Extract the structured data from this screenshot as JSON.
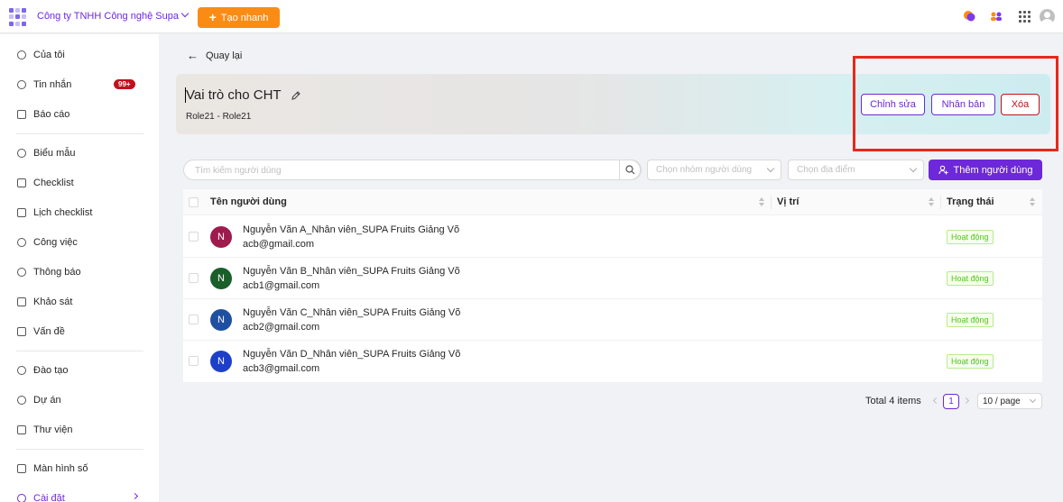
{
  "topbar": {
    "company": "Công ty TNHH Công nghệ Supa",
    "quick_create": "Tạo nhanh"
  },
  "sidebar": {
    "items": [
      {
        "label": "Của tôi",
        "icon": "user-key-icon"
      },
      {
        "label": "Tin nhắn",
        "icon": "chat-icon",
        "badge": "99+"
      },
      {
        "label": "Báo cáo",
        "icon": "report-icon"
      },
      {
        "label": "Biểu mẫu",
        "icon": "form-icon"
      },
      {
        "label": "Checklist",
        "icon": "checklist-icon"
      },
      {
        "label": "Lịch checklist",
        "icon": "calendar-icon"
      },
      {
        "label": "Công việc",
        "icon": "task-icon"
      },
      {
        "label": "Thông báo",
        "icon": "bell-icon"
      },
      {
        "label": "Khảo sát",
        "icon": "survey-icon"
      },
      {
        "label": "Vấn đề",
        "icon": "issue-icon"
      },
      {
        "label": "Đào tạo",
        "icon": "training-icon"
      },
      {
        "label": "Dự án",
        "icon": "project-icon"
      },
      {
        "label": "Thư viện",
        "icon": "library-icon"
      },
      {
        "label": "Màn hình số",
        "icon": "monitor-icon"
      },
      {
        "label": "Cài đặt",
        "icon": "settings-icon"
      }
    ]
  },
  "back": "Quay lại",
  "role": {
    "title": "Vai trò cho CHT",
    "subtitle": "Role21 - Role21",
    "edit_label": "Chỉnh sửa",
    "duplicate_label": "Nhân bản",
    "delete_label": "Xóa"
  },
  "filters": {
    "search_placeholder": "Tìm kiếm người dùng",
    "group_placeholder": "Chọn nhóm người dùng",
    "location_placeholder": "Chọn địa điểm",
    "add_user": "Thêm người dùng"
  },
  "table": {
    "headers": {
      "name": "Tên người dùng",
      "position": "Vị trí",
      "status": "Trạng thái"
    },
    "rows": [
      {
        "initial": "N",
        "name": "Nguyễn Văn A_Nhân viên_SUPA Fruits Giảng Võ",
        "email": "acb@gmail.com",
        "position": "",
        "status": "Hoạt động",
        "color": "#9e1b4d"
      },
      {
        "initial": "N",
        "name": "Nguyễn Văn B_Nhân viên_SUPA Fruits Giảng Võ",
        "email": "acb1@gmail.com",
        "position": "",
        "status": "Hoạt động",
        "color": "#1a5e2a"
      },
      {
        "initial": "N",
        "name": "Nguyễn Văn C_Nhân viên_SUPA Fruits Giảng Võ",
        "email": "acb2@gmail.com",
        "position": "",
        "status": "Hoạt động",
        "color": "#1f4fa0"
      },
      {
        "initial": "N",
        "name": "Nguyễn Văn D_Nhân viên_SUPA Fruits Giảng Võ",
        "email": "acb3@gmail.com",
        "position": "",
        "status": "Hoạt động",
        "color": "#1e40c8"
      }
    ]
  },
  "pagination": {
    "total": "Total 4 items",
    "current": "1",
    "page_size": "10 / page"
  },
  "colors": {
    "accent": "#6d28d9",
    "orange": "#fa8c16",
    "danger": "#c0121d",
    "highlight": "#e8281b"
  }
}
